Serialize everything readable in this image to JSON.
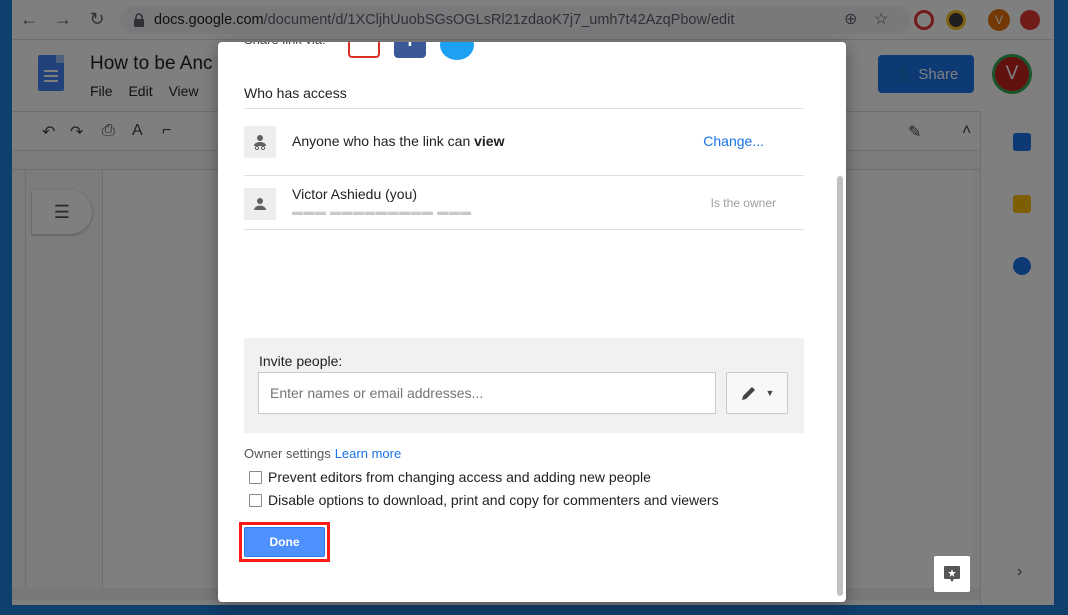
{
  "browser": {
    "url_host": "docs.google.com",
    "url_path": "/document/d/1XCljhUuobSGsOGLsRl21zdaoK7j7_umh7t42AzqPbow/edit",
    "profile_initial": "V"
  },
  "docs": {
    "title": "How to be Anc",
    "menu": [
      "File",
      "Edit",
      "View"
    ],
    "share_label": "Share",
    "avatar_initial": "V"
  },
  "dialog": {
    "share_via_label": "Share link via:",
    "who_has_access": "Who has access",
    "link_access": {
      "prefix": "Anyone who has the link can",
      "permission": "view",
      "change_label": "Change..."
    },
    "owner": {
      "name": "Victor Ashiedu (you)",
      "role": "Is the owner"
    },
    "invite": {
      "label": "Invite people:",
      "placeholder": "Enter names or email addresses..."
    },
    "owner_settings": {
      "label": "Owner settings",
      "learn_more": "Learn more",
      "options": [
        "Prevent editors from changing access and adding new people",
        "Disable options to download, print and copy for commenters and viewers"
      ]
    },
    "done_label": "Done"
  },
  "colors": {
    "accent": "#1a73e8",
    "done_button": "#4d90fe",
    "highlight": "#ff1a1a"
  }
}
